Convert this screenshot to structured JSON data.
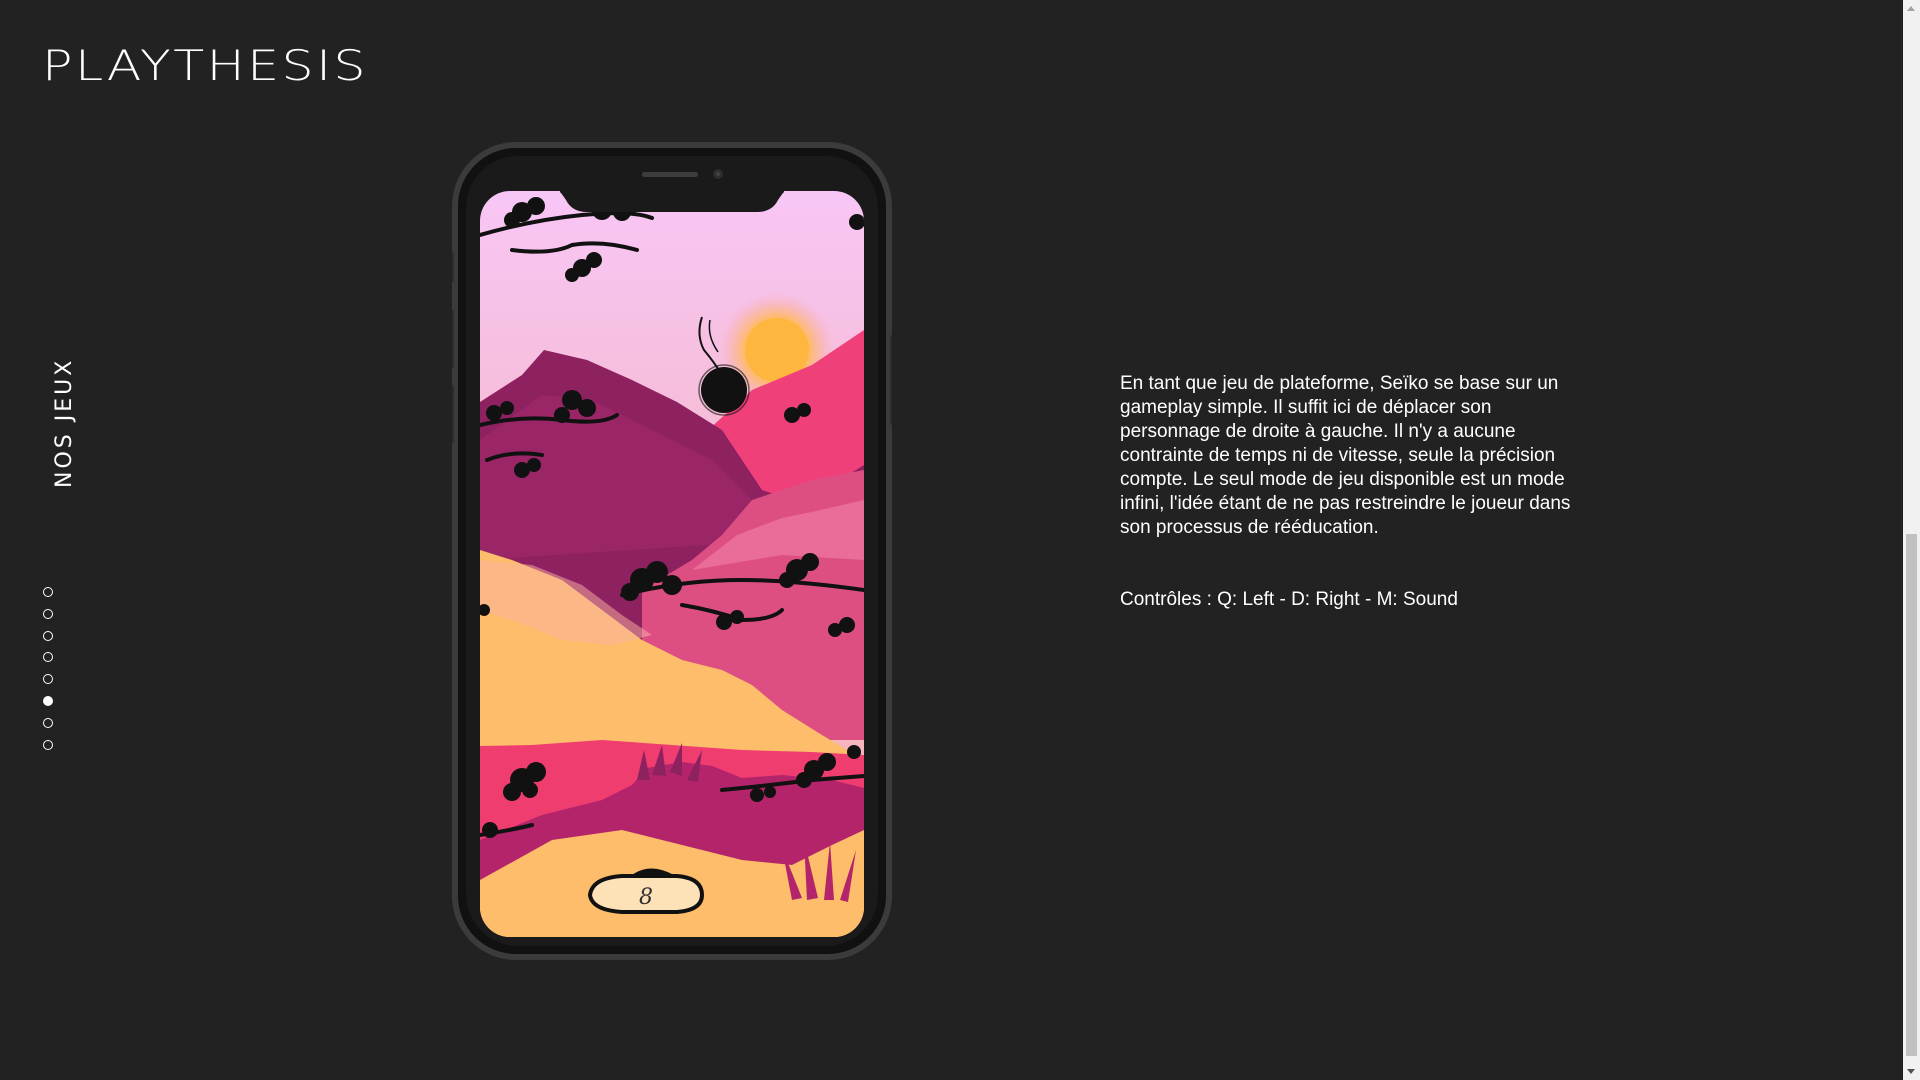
{
  "brand": {
    "logo_text": "PLAYTHESIS"
  },
  "section": {
    "title": "NOS JEUX"
  },
  "pagination": {
    "total": 8,
    "active_index": 5
  },
  "game": {
    "score": "8",
    "description": "En tant que jeu de plateforme, Seïko se base sur un gameplay simple. Il suffit ici de déplacer son personnage de droite à gauche. Il n'y a aucune contrainte de temps ni de vitesse, seule la précision compte. Le seul mode de jeu disponible est un mode infini, l'idée étant de ne pas restreindre le joueur dans son processus de rééducation.",
    "controls": "Contrôles : Q: Left - D: Right - M: Sound"
  },
  "colors": {
    "background": "#222222",
    "text": "#ffffff",
    "sky_top": "#f8c3f5",
    "sky_bottom": "#f7b3bf",
    "sun": "#ffb84a",
    "mountain_dark": "#8e2160",
    "mountain_pink": "#f0407a",
    "mountain_mid": "#d94f82",
    "sand": "#fdbd6a",
    "hill_magenta": "#b3246a",
    "hill_red": "#ef3d6f"
  }
}
